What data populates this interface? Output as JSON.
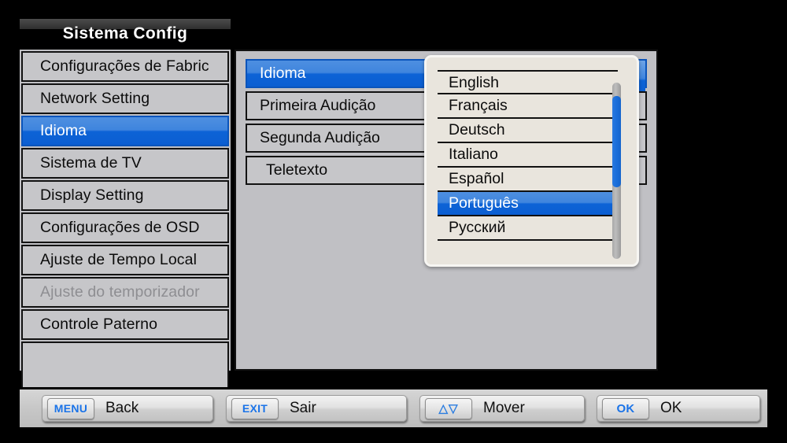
{
  "window": {
    "title": "Sistema Config"
  },
  "sidebar": {
    "items": [
      {
        "label": "Configurações de Fabric",
        "state": "normal"
      },
      {
        "label": "Network Setting",
        "state": "normal"
      },
      {
        "label": "Idioma",
        "state": "selected"
      },
      {
        "label": "Sistema de TV",
        "state": "normal"
      },
      {
        "label": "Display Setting",
        "state": "normal"
      },
      {
        "label": "Configurações de OSD",
        "state": "normal"
      },
      {
        "label": "Ajuste de Tempo Local",
        "state": "normal"
      },
      {
        "label": "Ajuste do temporizador",
        "state": "disabled"
      },
      {
        "label": "Controle Paterno",
        "state": "normal"
      }
    ]
  },
  "main": {
    "rows": [
      {
        "label": "Idioma",
        "state": "selected"
      },
      {
        "label": "Primeira Audição",
        "state": "normal"
      },
      {
        "label": "Segunda Audição",
        "state": "normal"
      },
      {
        "label": "Teletexto",
        "state": "indent"
      }
    ]
  },
  "popup": {
    "options": [
      {
        "label": "English",
        "state": "normal"
      },
      {
        "label": "Français",
        "state": "normal"
      },
      {
        "label": "Deutsch",
        "state": "normal"
      },
      {
        "label": "Italiano",
        "state": "normal"
      },
      {
        "label": "Español",
        "state": "normal"
      },
      {
        "label": "Português",
        "state": "selected"
      },
      {
        "label": "Русский",
        "state": "normal"
      }
    ],
    "selected_value": "Português"
  },
  "footer": {
    "hints": [
      {
        "key": "MENU",
        "label": "Back",
        "icon": "menu-key-icon"
      },
      {
        "key": "EXIT",
        "label": "Sair",
        "icon": "exit-key-icon"
      },
      {
        "key": "△▽",
        "label": "Mover",
        "icon": "up-down-arrows-icon"
      },
      {
        "key": "OK",
        "label": "OK",
        "icon": "ok-key-icon"
      }
    ]
  },
  "colors": {
    "accent_blue": "#0d63d6",
    "accent_blue_light": "#4e8fe0",
    "panel_gray": "#c0c0c4",
    "row_gray": "#c6c6c9",
    "popup_bg": "#e9e5dd",
    "key_text_blue": "#1a73e8",
    "disabled_text": "#8e8e92",
    "background": "#000000"
  }
}
